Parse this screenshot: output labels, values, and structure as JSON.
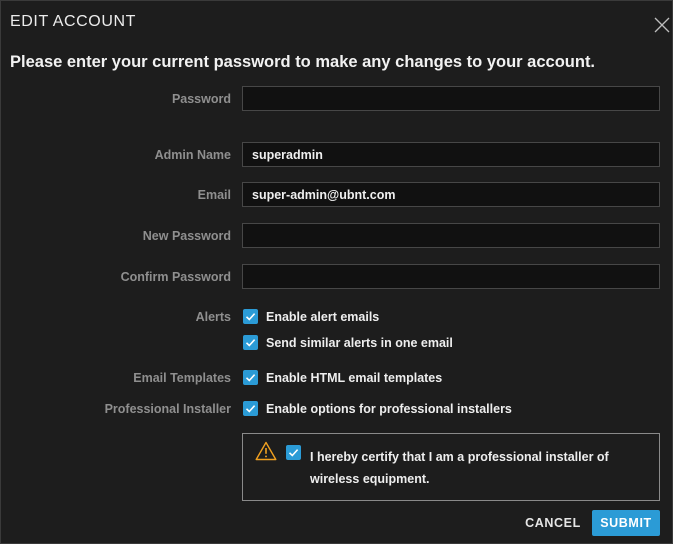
{
  "dialog": {
    "title": "EDIT ACCOUNT",
    "intro": "Please enter your current password to make any changes to your account."
  },
  "fields": {
    "password": {
      "label": "Password",
      "value": ""
    },
    "admin_name": {
      "label": "Admin Name",
      "value": "superadmin"
    },
    "email": {
      "label": "Email",
      "value": "super-admin@ubnt.com"
    },
    "new_password": {
      "label": "New Password",
      "value": ""
    },
    "confirm_password": {
      "label": "Confirm Password",
      "value": ""
    }
  },
  "alerts": {
    "label": "Alerts",
    "enable_alert_emails": {
      "label": "Enable alert emails",
      "checked": true
    },
    "send_similar_alerts": {
      "label": "Send similar alerts in one email",
      "checked": true
    }
  },
  "email_templates": {
    "label": "Email Templates",
    "enable_html": {
      "label": "Enable HTML email templates",
      "checked": true
    }
  },
  "professional_installer": {
    "label": "Professional Installer",
    "enable_options": {
      "label": "Enable options for professional installers",
      "checked": true
    },
    "certify": {
      "text": "I hereby certify that I am a professional installer of wireless equipment.",
      "checked": true
    }
  },
  "buttons": {
    "cancel": "CANCEL",
    "submit": "SUBMIT"
  },
  "icons": {
    "close": "close-icon",
    "check": "check-icon",
    "warning": "warning-icon"
  },
  "colors": {
    "accent": "#2b9bd6",
    "warning": "#f0a020",
    "background": "#1d1d1d"
  }
}
